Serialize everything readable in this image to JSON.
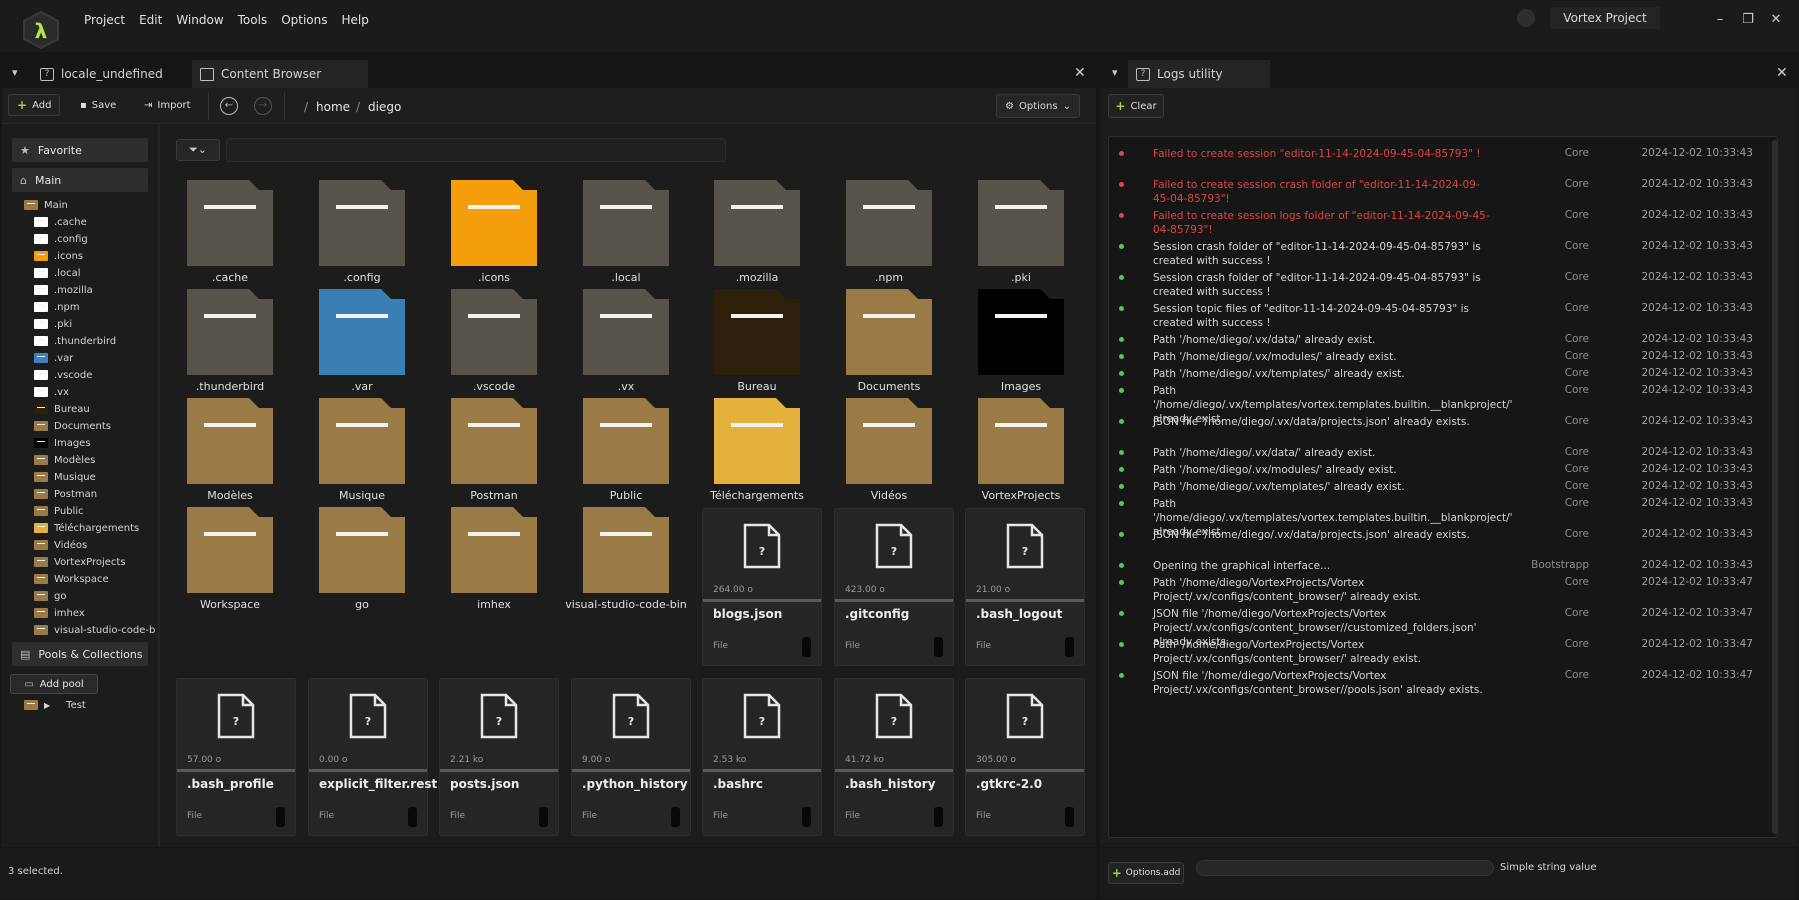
{
  "menu": [
    "Project",
    "Edit",
    "Window",
    "Tools",
    "Options",
    "Help"
  ],
  "project_name": "Vortex Project",
  "tabs_left": [
    {
      "label": "locale_undefined"
    },
    {
      "label": "Content Browser"
    }
  ],
  "tab_right": {
    "label": "Logs utility"
  },
  "toolbar": {
    "add": "Add",
    "save": "Save",
    "import": "Import",
    "options": "Options"
  },
  "breadcrumb": [
    "home",
    "diego"
  ],
  "sidebar": {
    "favorite": "Favorite",
    "main": "Main",
    "tree_root": "Main",
    "items": [
      {
        "label": ".cache",
        "color": "#ffffff"
      },
      {
        "label": ".config",
        "color": "#ffffff"
      },
      {
        "label": ".icons",
        "color": "#f59e0b"
      },
      {
        "label": ".local",
        "color": "#ffffff"
      },
      {
        "label": ".mozilla",
        "color": "#ffffff"
      },
      {
        "label": ".npm",
        "color": "#ffffff"
      },
      {
        "label": ".pki",
        "color": "#ffffff"
      },
      {
        "label": ".thunderbird",
        "color": "#ffffff"
      },
      {
        "label": ".var",
        "color": "#3b82c4"
      },
      {
        "label": ".vscode",
        "color": "#ffffff"
      },
      {
        "label": ".vx",
        "color": "#ffffff"
      },
      {
        "label": "Bureau",
        "color": "#2d1f0a"
      },
      {
        "label": "Documents",
        "color": "#9b7b45"
      },
      {
        "label": "Images",
        "color": "#000000"
      },
      {
        "label": "Modèles",
        "color": "#9b7b45"
      },
      {
        "label": "Musique",
        "color": "#9b7b45"
      },
      {
        "label": "Postman",
        "color": "#9b7b45"
      },
      {
        "label": "Public",
        "color": "#9b7b45"
      },
      {
        "label": "Téléchargements",
        "color": "#e4b23c"
      },
      {
        "label": "Vidéos",
        "color": "#9b7b45"
      },
      {
        "label": "VortexProjects",
        "color": "#9b7b45"
      },
      {
        "label": "Workspace",
        "color": "#9b7b45"
      },
      {
        "label": "go",
        "color": "#9b7b45"
      },
      {
        "label": "imhex",
        "color": "#9b7b45"
      },
      {
        "label": "visual-studio-code-b",
        "color": "#9b7b45"
      }
    ],
    "pools": "Pools & Collections",
    "add_pool": "Add pool",
    "pool_item": "Test"
  },
  "folders": [
    {
      "label": ".cache",
      "color": "#58534b"
    },
    {
      "label": ".config",
      "color": "#58534b"
    },
    {
      "label": ".icons",
      "color": "#f59e0b"
    },
    {
      "label": ".local",
      "color": "#58534b"
    },
    {
      "label": ".mozilla",
      "color": "#58534b"
    },
    {
      "label": ".npm",
      "color": "#58534b"
    },
    {
      "label": ".pki",
      "color": "#58534b"
    },
    {
      "label": ".thunderbird",
      "color": "#58534b"
    },
    {
      "label": ".var",
      "color": "#3a7fb4"
    },
    {
      "label": ".vscode",
      "color": "#58534b"
    },
    {
      "label": ".vx",
      "color": "#58534b"
    },
    {
      "label": "Bureau",
      "color": "#2d1f0a"
    },
    {
      "label": "Documents",
      "color": "#9b7b45"
    },
    {
      "label": "Images",
      "color": "#000000"
    },
    {
      "label": "Modèles",
      "color": "#9b7b45"
    },
    {
      "label": "Musique",
      "color": "#9b7b45"
    },
    {
      "label": "Postman",
      "color": "#9b7b45"
    },
    {
      "label": "Public",
      "color": "#9b7b45"
    },
    {
      "label": "Téléchargements",
      "color": "#e4b23c"
    },
    {
      "label": "Vidéos",
      "color": "#9b7b45"
    },
    {
      "label": "VortexProjects",
      "color": "#9b7b45"
    },
    {
      "label": "Workspace",
      "color": "#9b7b45"
    },
    {
      "label": "go",
      "color": "#9b7b45"
    },
    {
      "label": "imhex",
      "color": "#9b7b45"
    },
    {
      "label": "visual-studio-code-bin",
      "color": "#9b7b45"
    }
  ],
  "files": [
    {
      "name": "blogs.json",
      "size": "264.00 o",
      "type": "File"
    },
    {
      "name": ".gitconfig",
      "size": "423.00 o",
      "type": "File"
    },
    {
      "name": ".bash_logout",
      "size": "21.00 o",
      "type": "File"
    },
    {
      "name": ".bash_profile",
      "size": "57.00 o",
      "type": "File"
    },
    {
      "name": "explicit_filter.rest",
      "size": "0.00 o",
      "type": "File"
    },
    {
      "name": "posts.json",
      "size": "2.21 ko",
      "type": "File"
    },
    {
      "name": ".python_history",
      "size": "9.00 o",
      "type": "File"
    },
    {
      "name": ".bashrc",
      "size": "2.53 ko",
      "type": "File"
    },
    {
      "name": ".bash_history",
      "size": "41.72 ko",
      "type": "File"
    },
    {
      "name": ".gtkrc-2.0",
      "size": "305.00 o",
      "type": "File"
    }
  ],
  "status": "3 selected.",
  "logs_clear": "Clear",
  "logs": [
    {
      "level": "error",
      "msg": "Failed to create session \"editor-11-14-2024-09-45-04-85793\" !",
      "src": "Core",
      "time": "2024-12-02 10:33:43"
    },
    {
      "level": "error",
      "msg": "Failed to create session crash folder of \"editor-11-14-2024-09-45-04-85793\"!",
      "src": "Core",
      "time": "2024-12-02 10:33:43"
    },
    {
      "level": "error",
      "msg": "Failed to create session logs folder of \"editor-11-14-2024-09-45-04-85793\"!",
      "src": "Core",
      "time": "2024-12-02 10:33:43"
    },
    {
      "level": "ok",
      "msg": "Session crash folder of \"editor-11-14-2024-09-45-04-85793\" is created with success !",
      "src": "Core",
      "time": "2024-12-02 10:33:43"
    },
    {
      "level": "ok",
      "msg": "Session crash folder of \"editor-11-14-2024-09-45-04-85793\" is created with success !",
      "src": "Core",
      "time": "2024-12-02 10:33:43"
    },
    {
      "level": "ok",
      "msg": "Session topic files of \"editor-11-14-2024-09-45-04-85793\" is created with success !",
      "src": "Core",
      "time": "2024-12-02 10:33:43"
    },
    {
      "level": "ok",
      "msg": "Path '/home/diego/.vx/data/' already exist.",
      "src": "Core",
      "time": "2024-12-02 10:33:43"
    },
    {
      "level": "ok",
      "msg": "Path '/home/diego/.vx/modules/' already exist.",
      "src": "Core",
      "time": "2024-12-02 10:33:43"
    },
    {
      "level": "ok",
      "msg": "Path '/home/diego/.vx/templates/' already exist.",
      "src": "Core",
      "time": "2024-12-02 10:33:43"
    },
    {
      "level": "ok",
      "msg": "Path '/home/diego/.vx/templates/vortex.templates.builtin.__blankproject/' already exist.",
      "src": "Core",
      "time": "2024-12-02 10:33:43"
    },
    {
      "level": "ok",
      "msg": "JSON file '/home/diego/.vx/data/projects.json' already exists.",
      "src": "Core",
      "time": "2024-12-02 10:33:43"
    },
    {
      "level": "ok",
      "msg": "Path '/home/diego/.vx/data/' already exist.",
      "src": "Core",
      "time": "2024-12-02 10:33:43"
    },
    {
      "level": "ok",
      "msg": "Path '/home/diego/.vx/modules/' already exist.",
      "src": "Core",
      "time": "2024-12-02 10:33:43"
    },
    {
      "level": "ok",
      "msg": "Path '/home/diego/.vx/templates/' already exist.",
      "src": "Core",
      "time": "2024-12-02 10:33:43"
    },
    {
      "level": "ok",
      "msg": "Path '/home/diego/.vx/templates/vortex.templates.builtin.__blankproject/' already exist.",
      "src": "Core",
      "time": "2024-12-02 10:33:43"
    },
    {
      "level": "ok",
      "msg": "JSON file '/home/diego/.vx/data/projects.json' already exists.",
      "src": "Core",
      "time": "2024-12-02 10:33:43"
    },
    {
      "level": "ok",
      "msg": "Opening the graphical interface...",
      "src": "Bootstrapp",
      "time": "2024-12-02 10:33:43"
    },
    {
      "level": "ok",
      "msg": "Path '/home/diego/VortexProjects/Vortex Project/.vx/configs/content_browser/' already exist.",
      "src": "Core",
      "time": "2024-12-02 10:33:47"
    },
    {
      "level": "ok",
      "msg": "JSON file '/home/diego/VortexProjects/Vortex Project/.vx/configs/content_browser//customized_folders.json' already exists.",
      "src": "Core",
      "time": "2024-12-02 10:33:47"
    },
    {
      "level": "ok",
      "msg": "Path '/home/diego/VortexProjects/Vortex Project/.vx/configs/content_browser/' already exist.",
      "src": "Core",
      "time": "2024-12-02 10:33:47"
    },
    {
      "level": "ok",
      "msg": "JSON file '/home/diego/VortexProjects/Vortex Project/.vx/configs/content_browser//pools.json' already exists.",
      "src": "Core",
      "time": "2024-12-02 10:33:47"
    }
  ],
  "bottom_right": {
    "options_add": "Options.add",
    "string_label": "Simple string value"
  },
  "colors": {
    "accent_green": "#9bd44a",
    "error_red": "#e04444",
    "ok_green": "#4cd04c"
  }
}
